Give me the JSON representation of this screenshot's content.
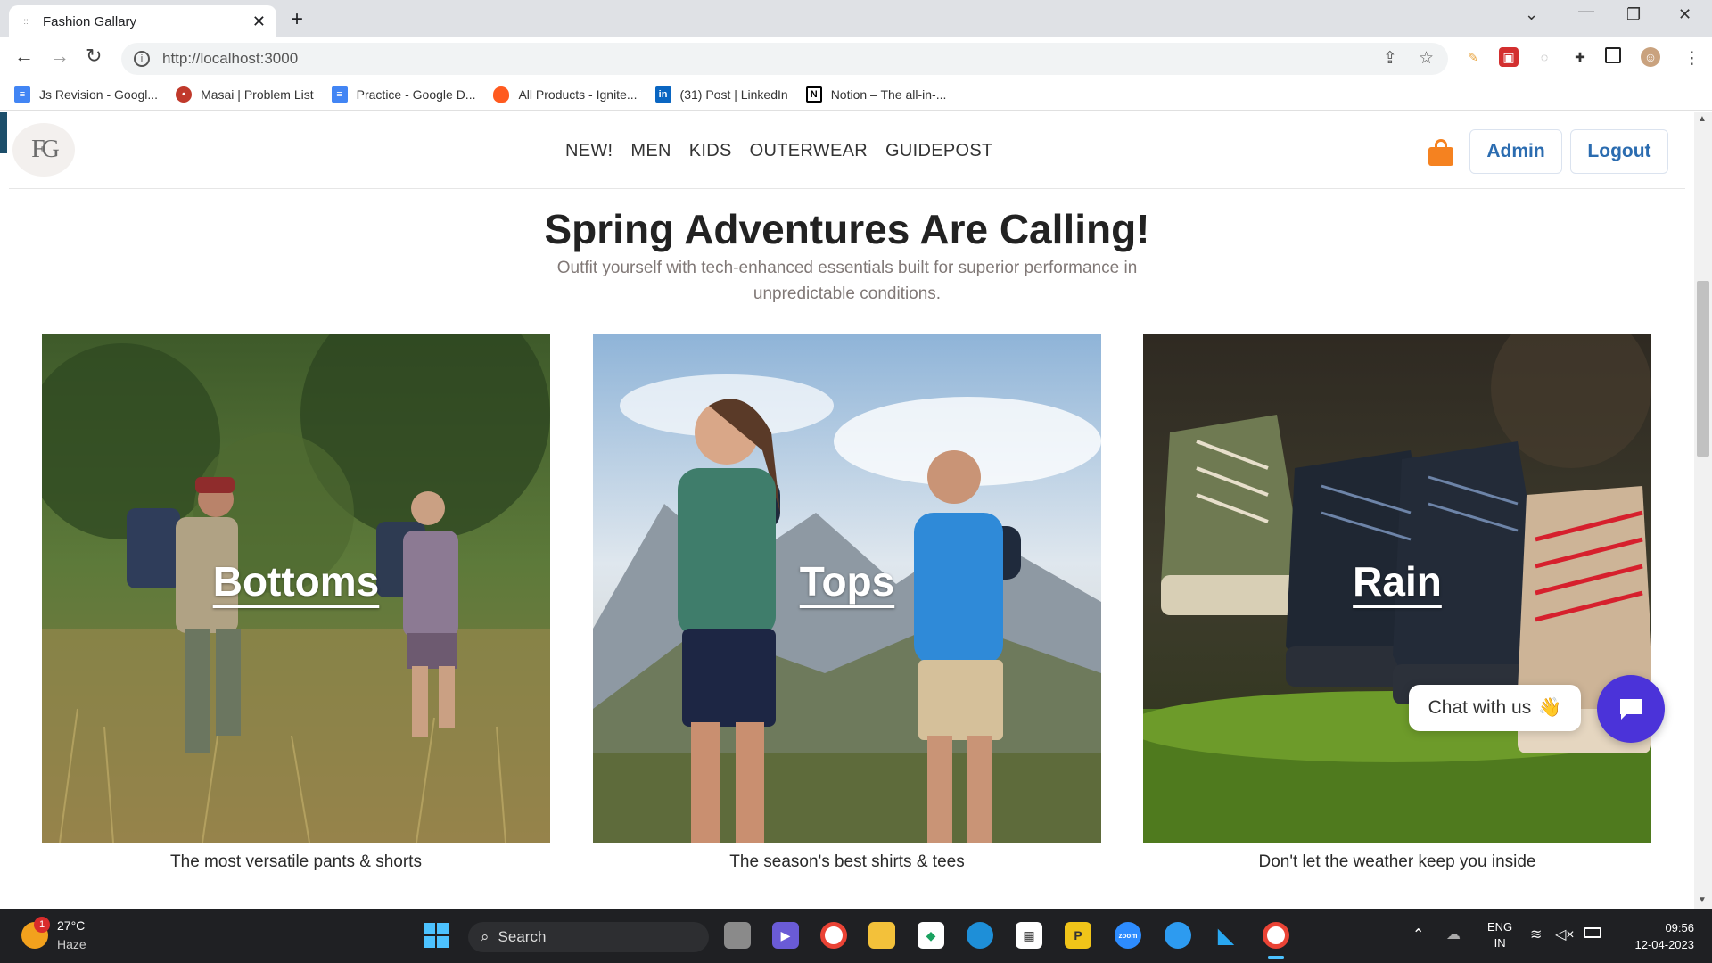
{
  "browser": {
    "tab_title": "Fashion Gallary",
    "url": "http://localhost:3000",
    "bookmarks": [
      {
        "label": "Js Revision - Googl...",
        "icon": "google-docs-icon",
        "color": "#4285f4"
      },
      {
        "label": "Masai | Problem List",
        "icon": "masai-icon",
        "color": "#c0392b"
      },
      {
        "label": "Practice - Google D...",
        "icon": "google-docs-icon",
        "color": "#4285f4"
      },
      {
        "label": "All Products - Ignite...",
        "icon": "fire-icon",
        "color": "#ff5a1f"
      },
      {
        "label": "(31) Post | LinkedIn",
        "icon": "linkedin-icon",
        "color": "#0a66c2"
      },
      {
        "label": "Notion – The all-in-...",
        "icon": "notion-icon",
        "color": "#000000"
      }
    ]
  },
  "site": {
    "logo_text": "FG",
    "nav": [
      "NEW!",
      "MEN",
      "KIDS",
      "OUTERWEAR",
      "GUIDEPOST"
    ],
    "admin_label": "Admin",
    "logout_label": "Logout",
    "accent_color": "#2b6cb0",
    "bag_color": "#f58220"
  },
  "hero": {
    "title": "Spring Adventures Are Calling!",
    "subtitle": "Outfit yourself with tech-enhanced essentials built for superior performance in unpredictable conditions."
  },
  "cards": [
    {
      "label": "Bottoms",
      "caption": "The most versatile pants & shorts"
    },
    {
      "label": "Tops",
      "caption": "The season's best shirts & tees"
    },
    {
      "label": "Rain",
      "caption": "Don't let the weather keep you inside"
    }
  ],
  "chat": {
    "label": "Chat with us",
    "emoji": "👋",
    "button_color": "#4b33d9"
  },
  "taskbar": {
    "temperature": "27°C",
    "weather": "Haze",
    "weather_badge": "1",
    "search_label": "Search",
    "lang_line1": "ENG",
    "lang_line2": "IN",
    "time": "09:56",
    "date": "12-04-2023"
  }
}
